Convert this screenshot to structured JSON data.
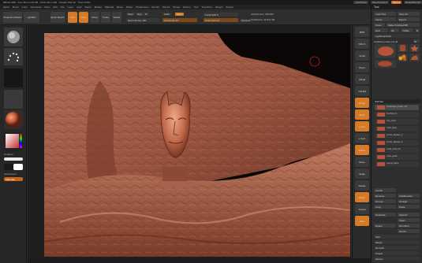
{
  "titlebar": {
    "app_info": "ZBrush 4R6 · Free Mem 2.06 GB · Active Mem 492 · Scratch Disk 42 · Timer 0.001",
    "quicksave": "QuickSave",
    "see_through": "See-through 0",
    "menus": "Menus",
    "default_script": "DefaultZScript"
  },
  "menubar": {
    "items": [
      "Alpha",
      "Brush",
      "Color",
      "Document",
      "Draw",
      "Edit",
      "File",
      "Layer",
      "Light",
      "Macro",
      "Marker",
      "Material",
      "Movie",
      "Picker",
      "Preferences",
      "Render",
      "Stencil",
      "Stroke",
      "Texture",
      "Tool",
      "Transform",
      "Zplugin",
      "Zscript"
    ]
  },
  "topshelf": {
    "projection_master": "Projection Master",
    "lightbox": "LightBox",
    "quick_sketch": "Quick Sketch",
    "edit": "Edit",
    "draw": "Draw",
    "move": "Move",
    "scale": "Scale",
    "rotate": "Rotate",
    "mrgb": "Mrgb",
    "rgb": "Rgb",
    "m": "M",
    "zadd": "Zadd",
    "zsub": "Zsub",
    "focal_shift": "Focal Shift 0",
    "draw_size": "Draw Size 64",
    "rgb_intensity": "Rgb Intensity 100",
    "z_intensity": "Z Intensity 25",
    "active_points": "ActivePoints: 252,822",
    "total_points": "TotalPoints: 30.541 Mil",
    "dynamic": "Dynamic"
  },
  "leftbar": {
    "gradient_label": "Gradient",
    "switch_color_label": "SwitchColor",
    "alternate_label": "Alternate"
  },
  "rightshelf": {
    "buttons": [
      "BPR",
      "SPix 3",
      "Scroll",
      "Zoom",
      "Actual",
      "AAHalf",
      "Persp",
      "Floor",
      "Local",
      "L.Sym",
      "Frame",
      "Move",
      "Scale",
      "Rotate",
      "PolyF",
      "Transp",
      "Solo"
    ]
  },
  "palette": {
    "title": "Tool",
    "load_tool": "Load Tool",
    "save_as": "Save As",
    "import": "Import",
    "export": "Export",
    "clone": "Clone",
    "make_polymesh3d": "Make PolyMesh3D",
    "goz": "GoZ",
    "all": "All",
    "visible": "Visible",
    "r": "R",
    "lightbox_tools": "Lightbox▸Tools",
    "current_tool": "Lunpfelsed_mester_ki2_48",
    "spix_value": "48",
    "thumb_labels": [
      "Cylinder3D",
      "PolyMesh3D",
      "SimpleBrush",
      "Lunpfelsed_mester_ki2",
      "sphere_k3"
    ],
    "subtool_header": "SubTool",
    "subtools": [
      "Lunpfelsed_mester_ki2",
      "SubTool_01",
      "face_head",
      "rocks_large",
      "terrain_displace_2",
      "terrain_displace_3",
      "small_rocks_03",
      "rocks_detail",
      "ground_plane"
    ],
    "list_all": "List All",
    "rename": "Rename",
    "auto_reorder": "AutoReorder",
    "all_low": "All Low",
    "all_high": "All High",
    "copy": "Copy",
    "paste": "Paste",
    "duplicate": "Duplicate",
    "append": "Append",
    "insert": "Insert",
    "delete": "Delete",
    "del_other": "Del Other",
    "del_all": "Del All",
    "split": "Split",
    "merge": "Merge",
    "remesh": "Remesh",
    "project": "Project",
    "extract": "Extract"
  },
  "colors": {
    "accent": "#d77a26",
    "background": "#2a2a2a",
    "clay": "#b5533a"
  }
}
